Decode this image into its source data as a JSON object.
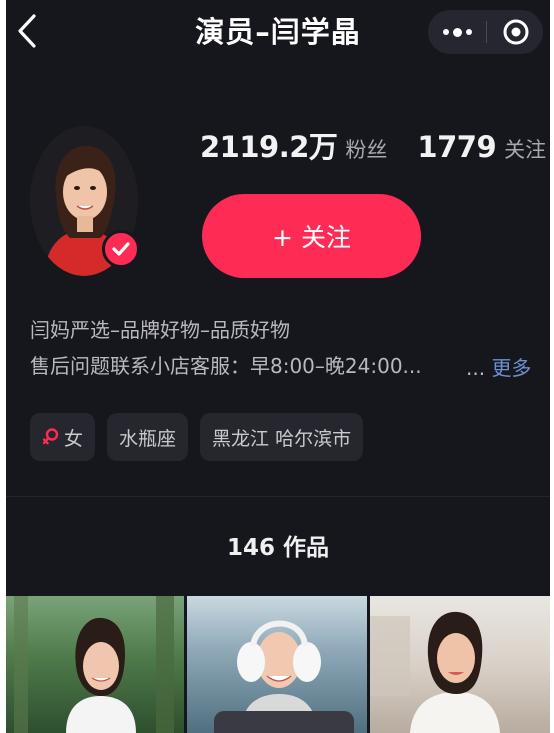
{
  "header": {
    "title": "演员–闫学晶"
  },
  "profile": {
    "followers_count": "2119.2万",
    "followers_label": "粉丝",
    "following_count": "1779",
    "following_label": "关注",
    "follow_button": "+ 关注",
    "bio_lines": [
      "闫妈严选–品牌好物–品质好物",
      "售后问题联系小店客服：早8:00–晚24:00..."
    ],
    "bio_more_dots": "...",
    "bio_more_link": "更多",
    "tags": {
      "gender": "女",
      "zodiac": "水瓶座",
      "location": "黑龙江 哈尔滨市"
    }
  },
  "works": {
    "count_label": "146 作品"
  },
  "colors": {
    "background": "#16161d",
    "accent": "#fe2c55",
    "link": "#6e8fd0",
    "gender_icon": "#fe2c55"
  },
  "icons": [
    "back-chevron-icon",
    "more-dots-icon",
    "close-target-icon",
    "verified-check-icon",
    "female-icon"
  ]
}
